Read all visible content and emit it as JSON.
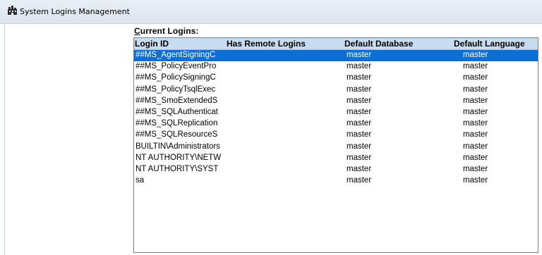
{
  "window": {
    "title": "System Logins Management",
    "icon": "building-icon"
  },
  "list": {
    "caption_hotkey": "C",
    "caption_rest": "urrent Logins:",
    "columns": [
      "Login ID",
      "Has Remote Logins",
      "Default Database",
      "Default Language"
    ],
    "selected_index": 0,
    "rows": [
      {
        "login_id": "##MS_AgentSigningC",
        "remote": "",
        "database": "master",
        "language": "master"
      },
      {
        "login_id": "##MS_PolicyEventPro",
        "remote": "",
        "database": "master",
        "language": "master"
      },
      {
        "login_id": "##MS_PolicySigningC",
        "remote": "",
        "database": "master",
        "language": "master"
      },
      {
        "login_id": "##MS_PolicyTsqlExec",
        "remote": "",
        "database": "master",
        "language": "master"
      },
      {
        "login_id": "##MS_SmoExtendedS",
        "remote": "",
        "database": "master",
        "language": "master"
      },
      {
        "login_id": "##MS_SQLAuthenticat",
        "remote": "",
        "database": "master",
        "language": "master"
      },
      {
        "login_id": "##MS_SQLReplication",
        "remote": "",
        "database": "master",
        "language": "master"
      },
      {
        "login_id": "##MS_SQLResourceS",
        "remote": "",
        "database": "master",
        "language": "master"
      },
      {
        "login_id": "BUILTIN\\Administrators",
        "remote": "",
        "database": "master",
        "language": "master"
      },
      {
        "login_id": "NT AUTHORITY\\NETW",
        "remote": "",
        "database": "master",
        "language": "master"
      },
      {
        "login_id": "NT AUTHORITY\\SYST",
        "remote": "",
        "database": "master",
        "language": "master"
      },
      {
        "login_id": "sa",
        "remote": "",
        "database": "master",
        "language": "master"
      }
    ]
  },
  "colors": {
    "selection": "#0b6fd6",
    "header_bg": "#c7dcf0"
  }
}
